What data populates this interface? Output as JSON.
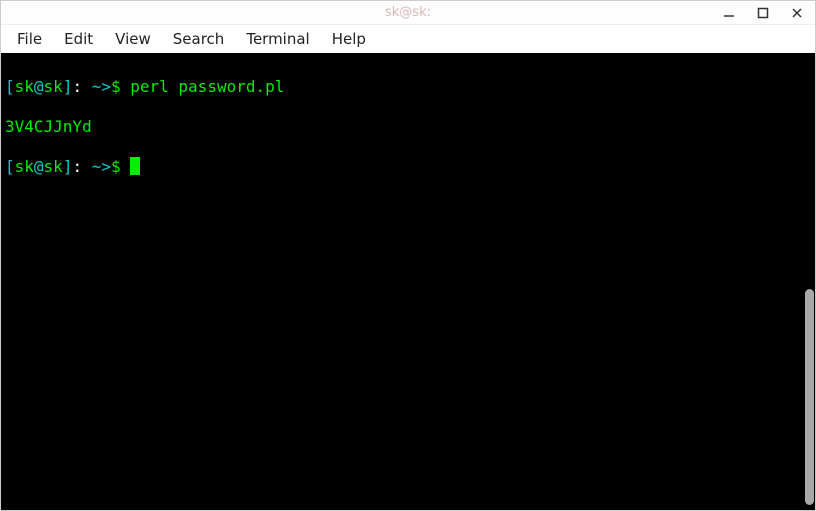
{
  "window": {
    "title": "sk@sk:"
  },
  "menubar": {
    "items": [
      "File",
      "Edit",
      "View",
      "Search",
      "Terminal",
      "Help"
    ]
  },
  "terminal": {
    "lines": [
      {
        "prompt": {
          "lb": "[",
          "user": "sk",
          "at": "@",
          "host": "sk",
          "rb": "]",
          "colon": ": ",
          "path": "~>",
          "dollar": "$ "
        },
        "command": "perl password.pl"
      },
      {
        "output": "3V4CJJnYd"
      },
      {
        "prompt": {
          "lb": "[",
          "user": "sk",
          "at": "@",
          "host": "sk",
          "rb": "]",
          "colon": ": ",
          "path": "~>",
          "dollar": "$ "
        },
        "command": ""
      }
    ]
  }
}
